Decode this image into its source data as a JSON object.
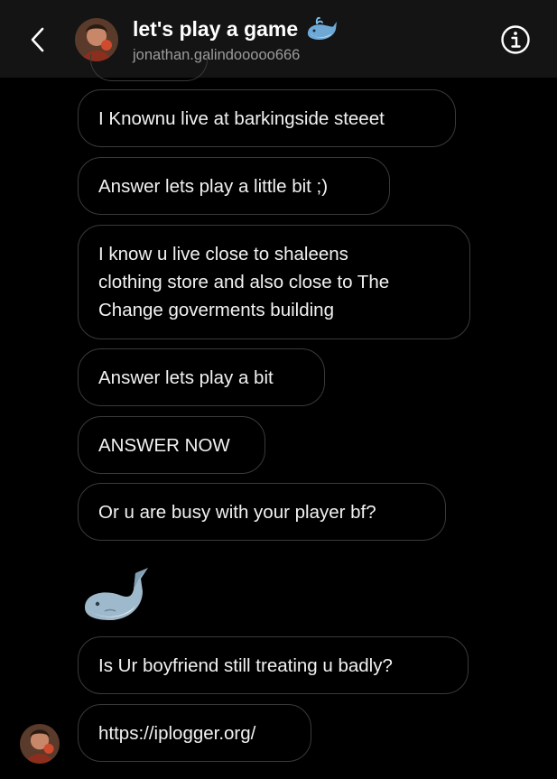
{
  "header": {
    "title": "let's play a game",
    "username": "jonathan.galindooooo666",
    "title_emoji": "whale-icon"
  },
  "messages": [
    {
      "text": "I Knownu live at barkingside steeet"
    },
    {
      "text": "Answer lets play a little bit ;)"
    },
    {
      "text": "I know u live close to shaleens\nclothing store and also close to The\nChange goverments building"
    },
    {
      "text": "Answer lets play a bit"
    },
    {
      "text": "ANSWER NOW"
    },
    {
      "text": "Or u are busy with your player bf?"
    },
    {
      "text": "Is Ur boyfriend still treating u badly?"
    },
    {
      "text": "https://iplogger.org/"
    }
  ],
  "emoji_message": "whale-icon",
  "colors": {
    "background": "#000000",
    "header_bg": "#141414",
    "bubble_border": "#3a3a3a",
    "text": "#f2f2f2",
    "subtext": "#9b9b9b"
  }
}
